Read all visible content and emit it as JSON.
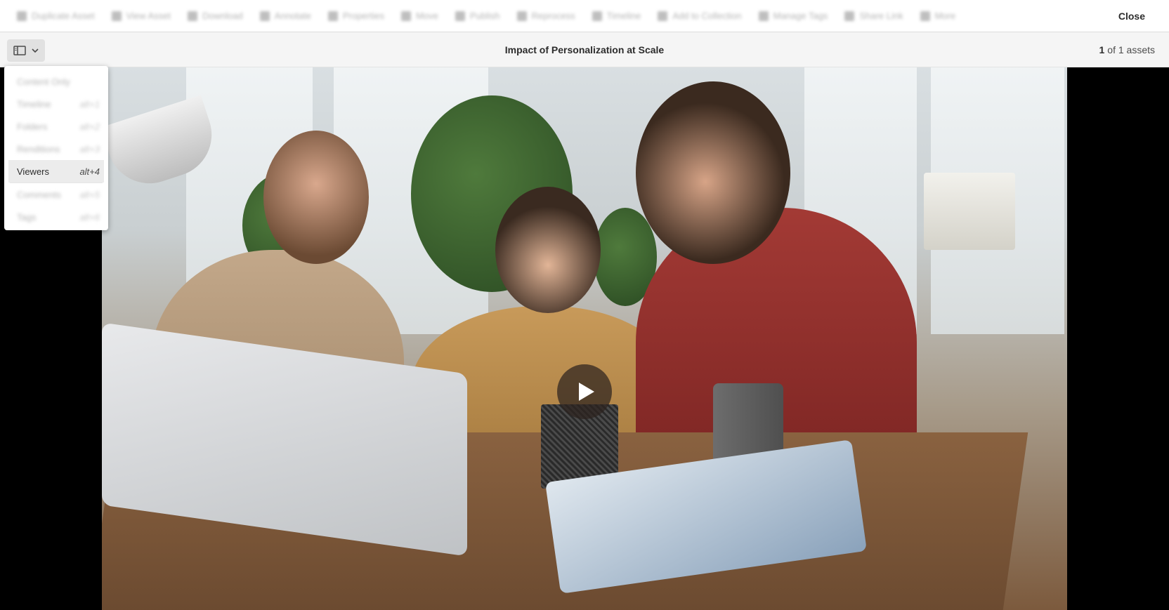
{
  "actionbar": {
    "actions": [
      {
        "label": "Duplicate Asset"
      },
      {
        "label": "View Asset"
      },
      {
        "label": "Download"
      },
      {
        "label": "Annotate"
      },
      {
        "label": "Properties"
      },
      {
        "label": "Move"
      },
      {
        "label": "Publish"
      },
      {
        "label": "Reprocess"
      },
      {
        "label": "Timeline"
      },
      {
        "label": "Add to Collection"
      },
      {
        "label": "Manage Tags"
      },
      {
        "label": "Share Link"
      },
      {
        "label": "More"
      }
    ],
    "close_label": "Close"
  },
  "titlebar": {
    "title": "Impact of Personalization at Scale",
    "counter_current": "1",
    "counter_rest": "of 1 assets"
  },
  "rail_menu": {
    "items": [
      {
        "label": "Content Only",
        "shortcut": "",
        "blurred": true
      },
      {
        "label": "Timeline",
        "shortcut": "alt+1",
        "blurred": true
      },
      {
        "label": "Folders",
        "shortcut": "alt+2",
        "blurred": true
      },
      {
        "label": "Renditions",
        "shortcut": "alt+3",
        "blurred": true
      },
      {
        "label": "Viewers",
        "shortcut": "alt+4",
        "blurred": false
      },
      {
        "label": "Comments",
        "shortcut": "alt+5",
        "blurred": true
      },
      {
        "label": "Tags",
        "shortcut": "alt+6",
        "blurred": true
      }
    ]
  },
  "colors": {
    "actionbar_bg": "#ffffff",
    "titlebar_bg": "#f5f5f5",
    "stage_bg": "#000000",
    "text_primary": "#2c2c2c"
  }
}
